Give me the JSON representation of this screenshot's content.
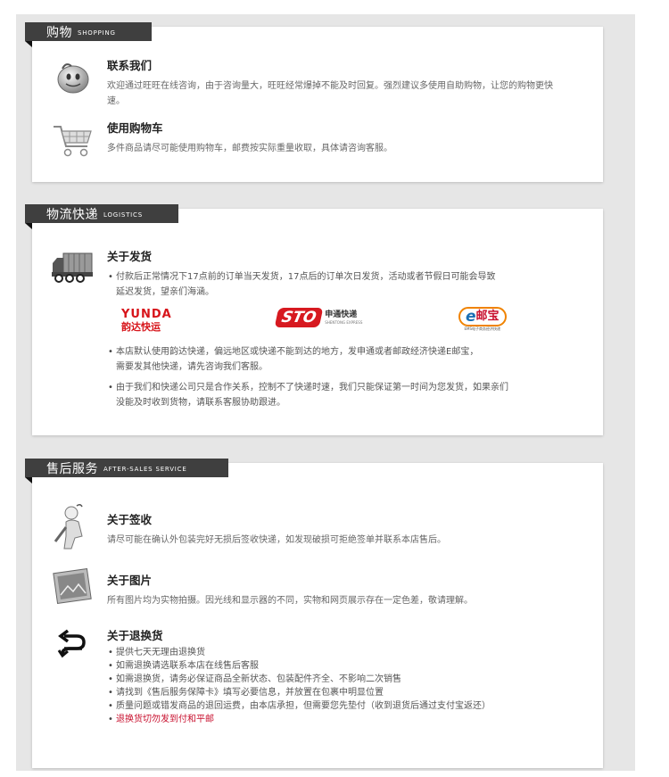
{
  "sections": {
    "shopping": {
      "title_zh": "购物",
      "title_en": "SHOPPING",
      "items": [
        {
          "title": "联系我们",
          "text": "欢迎通过旺旺在线咨询，由于咨询量大，旺旺经常爆掉不能及时回复。强烈建议多使用自助购物，让您的购物更快速。"
        },
        {
          "title": "使用购物车",
          "text": "多件商品请尽可能使用购物车，邮费按实际重量收取，具体请咨询客服。"
        }
      ]
    },
    "logistics": {
      "title_zh": "物流快递",
      "title_en": "LOGISTICS",
      "title": "关于发货",
      "bullet1_line1": "付款后正常情况下17点前的订单当天发货，17点后的订单次日发货，活动或者节假日可能会导致",
      "bullet1_line2": "延迟发货，望亲们海涵。",
      "bullet2_line1": "本店默认使用韵达快递，偏远地区或快递不能到达的地方，发申通或者邮政经济快递E邮宝，",
      "bullet2_line2": "需要发其他快递，请先咨询我们客服。",
      "bullet3_line1": "由于我们和快递公司只是合作关系，控制不了快递时速，我们只能保证第一时间为您发货，如果亲们",
      "bullet3_line2": "没能及时收到货物，请联系客服协助跟进。",
      "logos": {
        "yunda_en": "YUNDA",
        "yunda_zh": "韵达快运",
        "sto_en": "STO",
        "sto_zh": "申通快递",
        "sto_sub": "SHENTONG EXPRESS",
        "ems_e": "e",
        "ems_zh": "邮宝",
        "ems_sub": "EMS电子商务经济快递"
      }
    },
    "aftersales": {
      "title_zh": "售后服务",
      "title_en": "AFTER-SALES SERVICE",
      "items": [
        {
          "title": "关于签收",
          "text": "请尽可能在确认外包装完好无损后签收快递，如发现破损可拒绝签单并联系本店售后。"
        },
        {
          "title": "关于图片",
          "text": "所有图片均为实物拍摄。因光线和显示器的不同，实物和网页展示存在一定色差，敬请理解。"
        }
      ],
      "returns_title": "关于退换货",
      "returns_list": [
        "提供七天无理由退换货",
        "如需退换请选联系本店在线售后客服",
        "如需退换货，请务必保证商品全新状态、包装配件齐全、不影响二次销售",
        "请找到《售后服务保障卡》填写必要信息，并放置在包裹中明显位置",
        "质量问题或错发商品的退回运费，由本店承担，但需要您先垫付（收到退货后通过支付宝返还）"
      ],
      "returns_warning": "退换货切勿发到付和平邮"
    }
  },
  "colors": {
    "tab_bg": "#3f3f3f",
    "warning": "#c8102e",
    "yunda_red": "#d7141a",
    "sto_red": "#d71920",
    "ems_orange": "#f08300"
  }
}
